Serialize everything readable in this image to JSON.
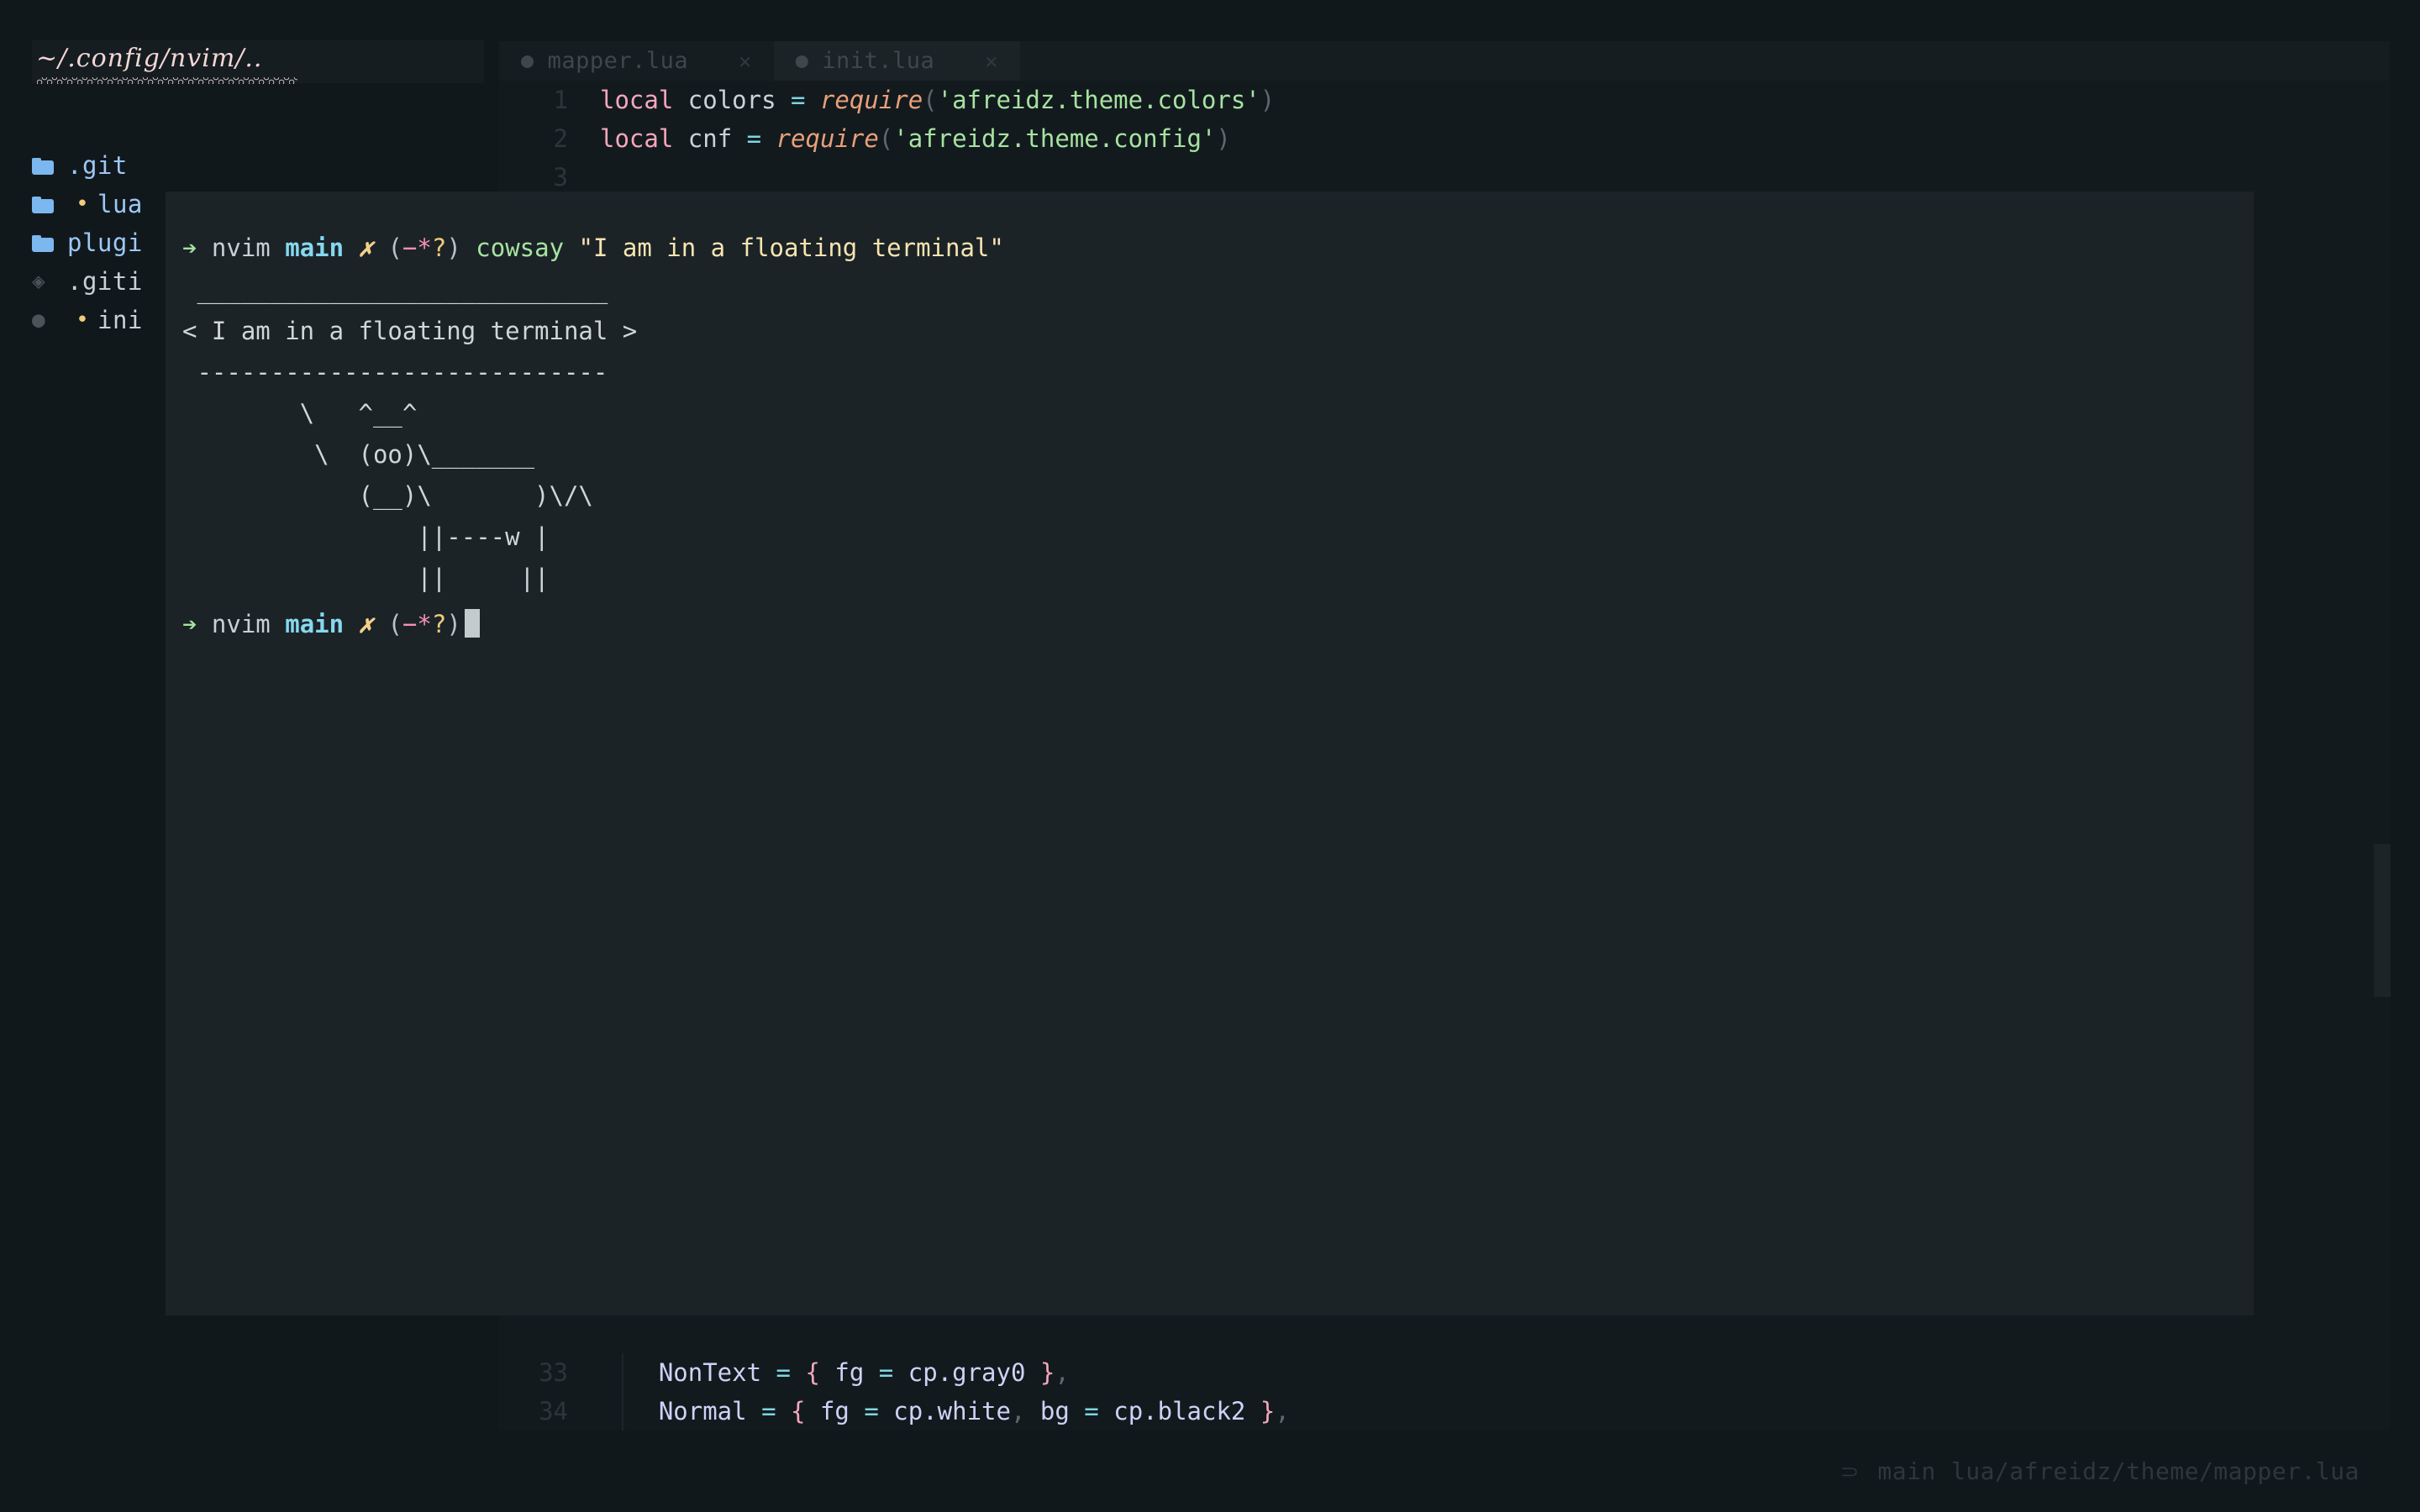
{
  "theme": {
    "screen_bg": "#11181c",
    "editor_bg": "#131a1e",
    "tabline_bg": "#161d21",
    "float_bg": "#1b2327",
    "accent_green": "#a6e3a1",
    "accent_blue": "#86d8ef",
    "accent_pink": "#f5a7bb",
    "accent_yellow": "#f2c97d"
  },
  "tabs": [
    {
      "label": "mapper.lua",
      "icon": "lua-icon",
      "close": "✕",
      "active": false
    },
    {
      "label": "init.lua",
      "icon": "lua-icon",
      "close": "✕",
      "active": true
    }
  ],
  "filetree": {
    "path": "~/.config/nvim/..",
    "items": [
      {
        "icon": "folder-icon",
        "modified": "",
        "name": ".git",
        "kind": "folder"
      },
      {
        "icon": "folder-icon",
        "modified": "•",
        "name": "lua",
        "kind": "folder"
      },
      {
        "icon": "folder-icon",
        "modified": "",
        "name": "plugi",
        "kind": "folder"
      },
      {
        "icon": "git-icon",
        "modified": "",
        "name": ".giti",
        "kind": "file"
      },
      {
        "icon": "lua-icon",
        "modified": "•",
        "name": "ini",
        "kind": "file"
      }
    ]
  },
  "code_top": [
    {
      "num": "1",
      "tokens": [
        {
          "t": "local",
          "c": "kw"
        },
        {
          "t": " ",
          "c": "ctext"
        },
        {
          "t": "colors",
          "c": "var"
        },
        {
          "t": " ",
          "c": "ctext"
        },
        {
          "t": "=",
          "c": "op"
        },
        {
          "t": " ",
          "c": "ctext"
        },
        {
          "t": "require",
          "c": "fn"
        },
        {
          "t": "(",
          "c": "punc"
        },
        {
          "t": "'afreidz.theme.colors'",
          "c": "str"
        },
        {
          "t": ")",
          "c": "punc"
        }
      ]
    },
    {
      "num": "2",
      "tokens": [
        {
          "t": "local",
          "c": "kw"
        },
        {
          "t": " ",
          "c": "ctext"
        },
        {
          "t": "cnf",
          "c": "var"
        },
        {
          "t": " ",
          "c": "ctext"
        },
        {
          "t": "=",
          "c": "op"
        },
        {
          "t": " ",
          "c": "ctext"
        },
        {
          "t": "require",
          "c": "fn"
        },
        {
          "t": "(",
          "c": "punc"
        },
        {
          "t": "'afreidz.theme.config'",
          "c": "str"
        },
        {
          "t": ")",
          "c": "punc"
        }
      ]
    },
    {
      "num": "3",
      "tokens": []
    }
  ],
  "code_bottom": [
    {
      "num": "33",
      "tokens": [
        {
          "t": "    ",
          "c": "ctext"
        },
        {
          "t": "NonText",
          "c": "prop"
        },
        {
          "t": " ",
          "c": "ctext"
        },
        {
          "t": "=",
          "c": "op"
        },
        {
          "t": " ",
          "c": "ctext"
        },
        {
          "t": "{",
          "c": "kw"
        },
        {
          "t": " ",
          "c": "ctext"
        },
        {
          "t": "fg",
          "c": "prop"
        },
        {
          "t": " ",
          "c": "ctext"
        },
        {
          "t": "=",
          "c": "op"
        },
        {
          "t": " ",
          "c": "ctext"
        },
        {
          "t": "cp.gray0",
          "c": "prop"
        },
        {
          "t": " ",
          "c": "ctext"
        },
        {
          "t": "}",
          "c": "kw"
        },
        {
          "t": ",",
          "c": "punc"
        }
      ]
    },
    {
      "num": "34",
      "tokens": [
        {
          "t": "    ",
          "c": "ctext"
        },
        {
          "t": "Normal",
          "c": "prop"
        },
        {
          "t": " ",
          "c": "ctext"
        },
        {
          "t": "=",
          "c": "op"
        },
        {
          "t": " ",
          "c": "ctext"
        },
        {
          "t": "{",
          "c": "kw"
        },
        {
          "t": " ",
          "c": "ctext"
        },
        {
          "t": "fg",
          "c": "prop"
        },
        {
          "t": " ",
          "c": "ctext"
        },
        {
          "t": "=",
          "c": "op"
        },
        {
          "t": " ",
          "c": "ctext"
        },
        {
          "t": "cp.white",
          "c": "prop"
        },
        {
          "t": ",",
          "c": "punc"
        },
        {
          "t": " ",
          "c": "ctext"
        },
        {
          "t": "bg",
          "c": "prop"
        },
        {
          "t": " ",
          "c": "ctext"
        },
        {
          "t": "=",
          "c": "op"
        },
        {
          "t": " ",
          "c": "ctext"
        },
        {
          "t": "cp.black2",
          "c": "prop"
        },
        {
          "t": " ",
          "c": "ctext"
        },
        {
          "t": "}",
          "c": "kw"
        },
        {
          "t": ",",
          "c": "punc"
        }
      ]
    }
  ],
  "statusline": {
    "branch_icon": "⸧",
    "branch": "main",
    "file": "lua/afreidz/theme/mapper.lua"
  },
  "terminal": {
    "prompt_arrow": "➔",
    "prompt_shell": "nvim",
    "prompt_branch": "main",
    "prompt_dirty": "✗",
    "prompt_status_open": "(",
    "prompt_status_dash": "−",
    "prompt_status_star": "*",
    "prompt_status_q": "?",
    "prompt_status_close": ")",
    "command": "cowsay",
    "command_arg": "\"I am in a floating terminal\"",
    "output": [
      " ____________________________",
      "< I am in a floating terminal >",
      " ----------------------------",
      "        \\   ^__^",
      "         \\  (oo)\\_______",
      "            (__)\\       )\\/\\",
      "                ||----w |",
      "                ||     ||"
    ]
  }
}
